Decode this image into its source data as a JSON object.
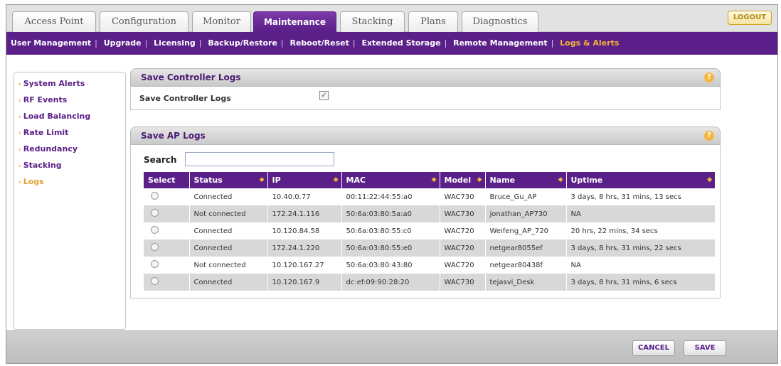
{
  "tabs": [
    {
      "label": "Access Point"
    },
    {
      "label": "Configuration"
    },
    {
      "label": "Monitor"
    },
    {
      "label": "Maintenance"
    },
    {
      "label": "Stacking"
    },
    {
      "label": "Plans"
    },
    {
      "label": "Diagnostics"
    }
  ],
  "logout_label": "LOGOUT",
  "subnav": [
    {
      "label": "User Management"
    },
    {
      "label": "Upgrade"
    },
    {
      "label": "Licensing"
    },
    {
      "label": "Backup/Restore"
    },
    {
      "label": "Reboot/Reset"
    },
    {
      "label": "Extended Storage"
    },
    {
      "label": "Remote Management"
    },
    {
      "label": "Logs & Alerts"
    }
  ],
  "sidemenu": [
    {
      "label": "System Alerts"
    },
    {
      "label": "RF Events"
    },
    {
      "label": "Load Balancing"
    },
    {
      "label": "Rate Limit"
    },
    {
      "label": "Redundancy"
    },
    {
      "label": "Stacking"
    },
    {
      "label": "Logs"
    }
  ],
  "controller_panel": {
    "title": "Save Controller Logs",
    "field_label": "Save Controller Logs",
    "checkbox_mark": "✓"
  },
  "ap_panel": {
    "title": "Save AP Logs",
    "search_label": "Search",
    "search_value": ""
  },
  "help_glyph": "?",
  "table": {
    "columns": [
      "Select",
      "Status",
      "IP",
      "MAC",
      "Model",
      "Name",
      "Uptime"
    ],
    "rows": [
      [
        "Connected",
        "10.40.0.77",
        "00:11:22:44:55:a0",
        "WAC730",
        "Bruce_Gu_AP",
        "3 days, 8 hrs, 31 mins, 13 secs"
      ],
      [
        "Not connected",
        "172.24.1.116",
        "50:6a:03:80:5a:a0",
        "WAC730",
        "jonathan_AP730",
        "NA"
      ],
      [
        "Connected",
        "10.120.84.58",
        "50:6a:03:80:55:c0",
        "WAC720",
        "Weifeng_AP_720",
        "20 hrs, 22 mins, 34 secs"
      ],
      [
        "Connected",
        "172.24.1.220",
        "50:6a:03:80:55:e0",
        "WAC720",
        "netgear8055ef",
        "3 days, 8 hrs, 31 mins, 22 secs"
      ],
      [
        "Not connected",
        "10.120.167.27",
        "50:6a:03:80:43:80",
        "WAC720",
        "netgear80438f",
        "NA"
      ],
      [
        "Connected",
        "10.120.167.9",
        "dc:ef:09:90:28:20",
        "WAC730",
        "tejasvi_Desk",
        "3 days, 8 hrs, 31 mins, 6 secs"
      ]
    ]
  },
  "buttons": {
    "cancel": "CANCEL",
    "save": "SAVE"
  },
  "colors": {
    "brand_purple": "#5a1f88",
    "accent_orange": "#f1b33a"
  }
}
